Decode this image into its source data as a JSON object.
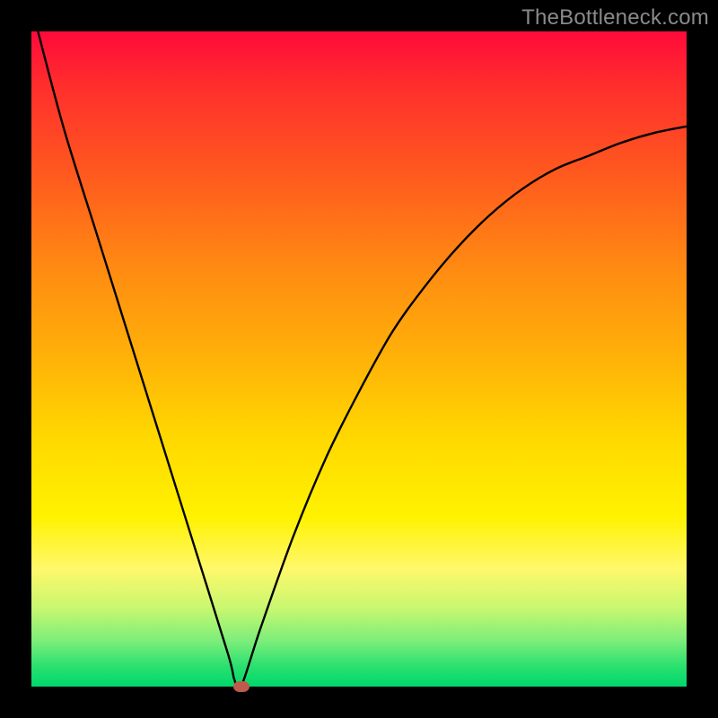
{
  "watermark": "TheBottleneck.com",
  "chart_data": {
    "type": "line",
    "title": "",
    "xlabel": "",
    "ylabel": "",
    "xlim": [
      0,
      100
    ],
    "ylim": [
      0,
      100
    ],
    "grid": false,
    "legend": false,
    "series": [
      {
        "name": "bottleneck-curve",
        "x": [
          1,
          5,
          10,
          15,
          20,
          25,
          30,
          31,
          32,
          35,
          40,
          45,
          50,
          55,
          60,
          65,
          70,
          75,
          80,
          85,
          90,
          95,
          100
        ],
        "y": [
          100,
          85,
          69,
          53,
          37,
          21,
          5,
          1,
          0,
          9,
          23,
          35,
          45,
          54,
          61,
          67,
          72,
          76,
          79,
          81,
          83,
          84.5,
          85.5
        ]
      }
    ],
    "min_point": {
      "x": 32,
      "y": 0
    },
    "gradient_stops": [
      {
        "pos": 0,
        "color": "#ff0a3a"
      },
      {
        "pos": 50,
        "color": "#ffd800"
      },
      {
        "pos": 100,
        "color": "#00d86a"
      }
    ]
  }
}
